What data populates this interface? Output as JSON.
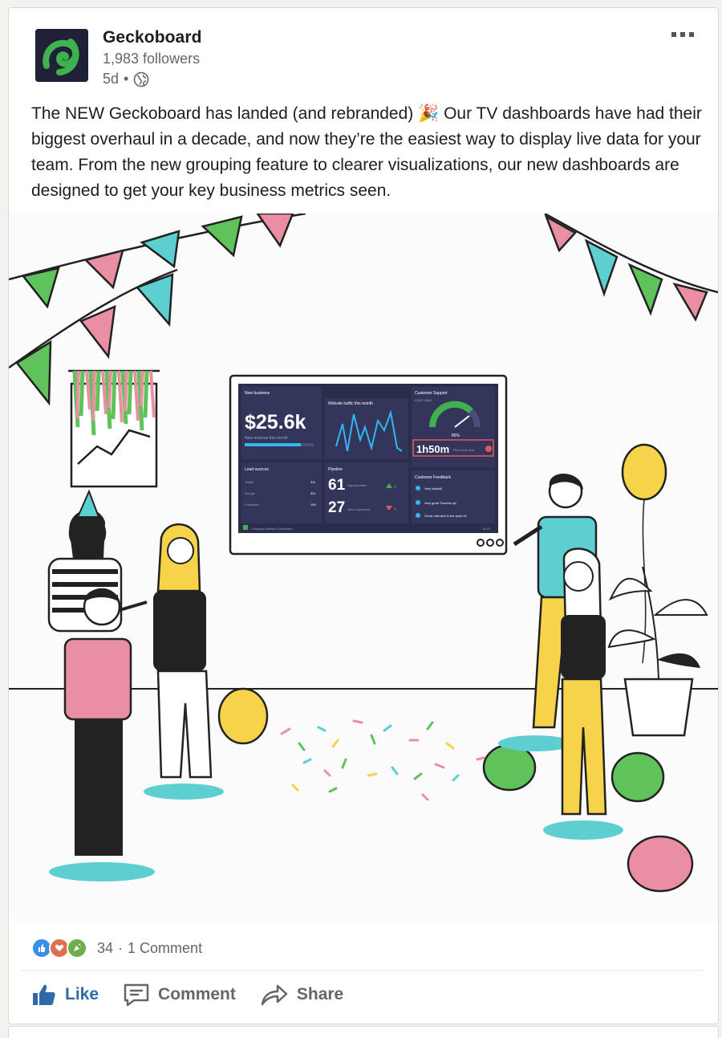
{
  "post": {
    "company_name": "Geckoboard",
    "followers": "1,983 followers",
    "time_ago": "5d",
    "separator": "•",
    "text": "The NEW Geckoboard has landed (and rebranded) 🎉  Our TV dashboards have had their biggest overhaul in a decade, and now they’re the easiest way to display live data for your team. From the new grouping feature to clearer visualizations, our new dashboards are designed to get your key business metrics seen."
  },
  "dashboard": {
    "new_business_title": "New business",
    "revenue": "$25.6k",
    "revenue_caption": "New revenue this month",
    "traffic_title": "Website traffic this month",
    "support_title": "Customer Support",
    "csat_label": "CSAT (30d)",
    "csat_value": "85%",
    "reply_time": "1h50m",
    "reply_caption": "First reply time",
    "lead_sources_title": "Lead sources",
    "lead_rows": [
      {
        "name": "Twitter",
        "value": "311"
      },
      {
        "name": "Google",
        "value": "301"
      },
      {
        "name": "Facebook",
        "value": "159"
      }
    ],
    "pipeline_title": "Pipeline",
    "opportunities": "61",
    "opportunities_label": "Opportunities",
    "opportunities_delta": "4",
    "new_customers": "27",
    "new_customers_label": "New Customers",
    "new_customers_delta": "4",
    "feedback_title": "Customer Feedback",
    "feedback": [
      "Very helpful!",
      "Very good \"thumbs up\"",
      "Great, fast and to the point #1"
    ],
    "footer_name": "Company Metrics Dashboard",
    "footer_time": "14:22"
  },
  "social": {
    "reaction_count": "34",
    "dot": "·",
    "comment_count": "1 Comment"
  },
  "actions": {
    "like": "Like",
    "comment": "Comment",
    "share": "Share"
  },
  "colors": {
    "like_blue": "#2d6aa6",
    "gecko_green": "#3fb24f",
    "logo_bg": "#1f2136",
    "bunting_pink": "#ea8fa3",
    "bunting_teal": "#5dcfd0",
    "bunting_green": "#5fc25a",
    "balloon_yellow": "#f6d34a"
  }
}
